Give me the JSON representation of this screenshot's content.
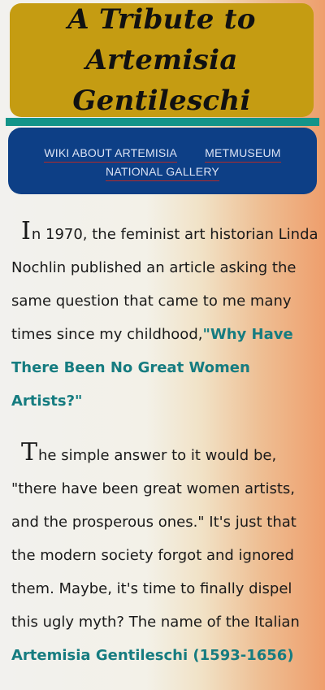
{
  "header": {
    "title_line1": "A Tribute to Artemisia",
    "title_line2": "Gentileschi"
  },
  "nav": {
    "links": [
      {
        "label": "WIKI ABOUT ARTEMISIA"
      },
      {
        "label": "METMUSEUM"
      },
      {
        "label": "NATIONAL GALLERY"
      }
    ]
  },
  "content": {
    "para1": {
      "dropcap": "I",
      "text": "n 1970, the feminist art historian Linda Nochlin published an article asking the same question that came to me many times since my childhood,",
      "highlight": "\"Why Have There Been No Great Women Artists?\""
    },
    "para2": {
      "dropcap": "T",
      "text": "he simple answer to it would be, \"there have been great women artists, and the prosperous ones.\" It's just that the modern society forgot and ignored them. Maybe, it's time to finally dispel this ugly myth? The name of the Italian",
      "highlight": "Artemisia Gentileschi (1593-1656)"
    }
  },
  "colors": {
    "header_bg": "#c59c12",
    "teal_bar": "#139489",
    "nav_bg": "#0d3f86",
    "highlight_text": "#167c80",
    "link_underline": "#b22a2a"
  }
}
